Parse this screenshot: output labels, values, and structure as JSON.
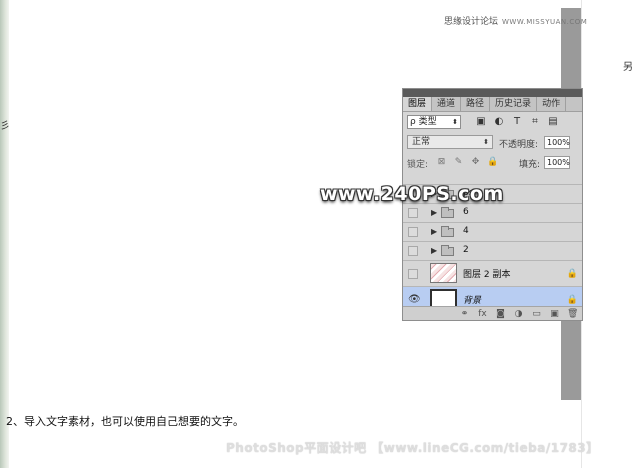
{
  "site_tag": {
    "cn": "思缘设计论坛",
    "url": "WWW.MISSYUAN.COM"
  },
  "panel": {
    "tabs": [
      "图层",
      "通道",
      "路径",
      "历史记录",
      "动作"
    ],
    "filter": {
      "label": "ρ 类型",
      "icons": [
        "image-filter-icon",
        "adjustment-filter-icon",
        "type-filter-icon",
        "shape-filter-icon",
        "smart-object-filter-icon"
      ],
      "glyphs": [
        "▣",
        "◐",
        "T",
        "⌗",
        "▤"
      ]
    },
    "blend_mode": "正常",
    "opacity_label": "不透明度:",
    "opacity_value": "100%",
    "lock_label": "锁定:",
    "lock_icons": [
      "⊠",
      "✎",
      "✥",
      "🔒"
    ],
    "fill_label": "填充:",
    "fill_value": "100%",
    "layers": [
      {
        "name": "ps",
        "type": "group"
      },
      {
        "name": "6",
        "type": "group"
      },
      {
        "name": "4",
        "type": "group"
      },
      {
        "name": "2",
        "type": "group"
      },
      {
        "name": "图层 2 副本",
        "type": "layer"
      },
      {
        "name": "背景",
        "type": "background"
      }
    ],
    "bottom_icons": [
      "⚭",
      "fx",
      "◙",
      "◑",
      "▭",
      "▣",
      "🗑"
    ]
  },
  "watermark": "www.240PS.com",
  "caption": "2、导入文字素材，也可以使用自己想要的文字。",
  "footer_watermark": "PhotoShop平面设计吧 【www.lineCG.com/tieba/1783】"
}
